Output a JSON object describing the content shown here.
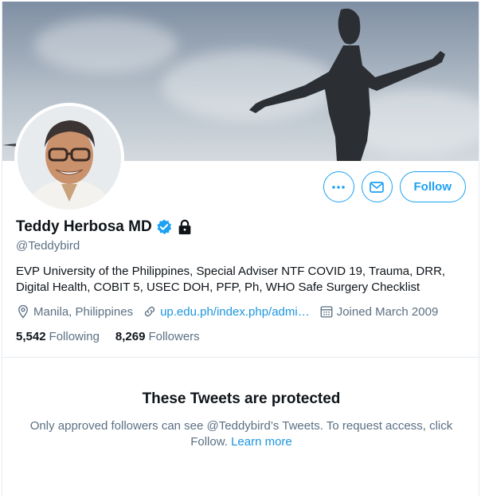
{
  "profile": {
    "display_name": "Teddy Herbosa MD",
    "handle": "@Teddybird",
    "bio": "EVP University of the Philippines, Special Adviser NTF COVID 19, Trauma, DRR, Digital Health, COBIT 5, USEC DOH, PFP, Ph, WHO Safe Surgery Checklist",
    "location": "Manila, Philippines",
    "website": "up.edu.ph/index.php/admi…",
    "joined": "Joined March 2009",
    "verified": true,
    "protected": true
  },
  "stats": {
    "following_count": "5,542",
    "following_label": "Following",
    "followers_count": "8,269",
    "followers_label": "Followers"
  },
  "actions": {
    "follow_label": "Follow",
    "more_icon": "more-icon",
    "message_icon": "envelope-icon"
  },
  "protected_notice": {
    "title": "These Tweets are protected",
    "body": "Only approved followers can see @Teddybird’s Tweets. To request access, click Follow.",
    "learn_more": "Learn more"
  },
  "colors": {
    "accent": "#1da1f2",
    "link": "#1b95e0",
    "secondary_text": "#5b7083",
    "primary_text": "#0f1419"
  }
}
